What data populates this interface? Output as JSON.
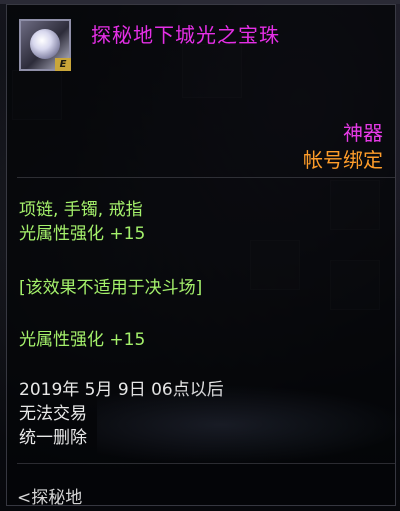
{
  "item": {
    "name": "探秘地下城光之宝珠",
    "rarity": "神器",
    "binding": "帐号绑定",
    "icon": "orb-icon",
    "icon_badge": "E"
  },
  "colors": {
    "name": "#e52fe6",
    "rarity": "#e63ae6",
    "binding": "#ff9d2a",
    "stats": "#a4f06b",
    "info": "#e8e8e8"
  },
  "stats": {
    "slots": "项链, 手镯, 戒指",
    "bonus_1": "光属性强化  +15",
    "restriction": "[该效果不适用于决斗场]",
    "bonus_2": "光属性强化  +15"
  },
  "info": {
    "date": "2019年  5月  9日  06点以后",
    "trade": "无法交易",
    "delete": "统一删除"
  },
  "footer": {
    "label": "<探秘地"
  }
}
